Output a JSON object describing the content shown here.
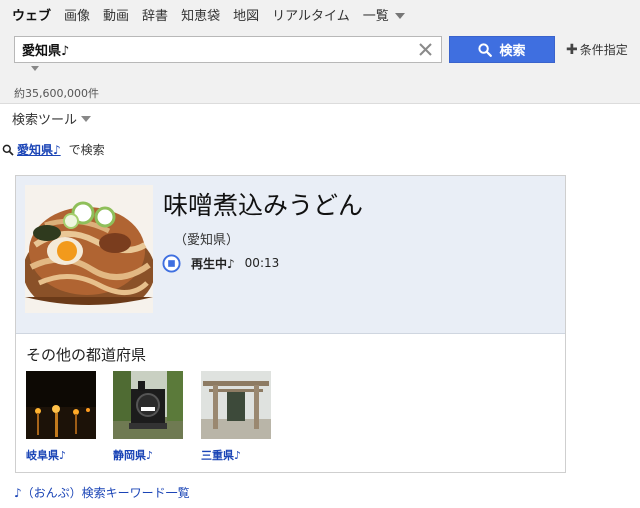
{
  "tabs": [
    {
      "label": "ウェブ",
      "active": true
    },
    {
      "label": "画像"
    },
    {
      "label": "動画"
    },
    {
      "label": "辞書"
    },
    {
      "label": "知恵袋"
    },
    {
      "label": "地図"
    },
    {
      "label": "リアルタイム"
    },
    {
      "label": "一覧"
    }
  ],
  "search": {
    "value": "愛知県♪",
    "button_label": "検索",
    "conditions_label": "条件指定"
  },
  "result_count": "約35,600,000件",
  "tools_label": "検索ツール",
  "suggestion": {
    "link": "愛知県♪",
    "suffix": "で検索"
  },
  "card": {
    "dish_title": "味噌煮込みうどん",
    "prefecture": "（愛知県）",
    "play_status": "再生中♪",
    "play_time": "00:13",
    "others_title": "その他の都道府県",
    "others": [
      {
        "label": "岐阜県♪"
      },
      {
        "label": "静岡県♪"
      },
      {
        "label": "三重県♪"
      }
    ]
  },
  "bottom_link": "♪（おんぷ）検索キーワード一覧",
  "colors": {
    "accent": "#3f6fe0",
    "link": "#1a44b6",
    "card_bg": "#e9eef6"
  }
}
